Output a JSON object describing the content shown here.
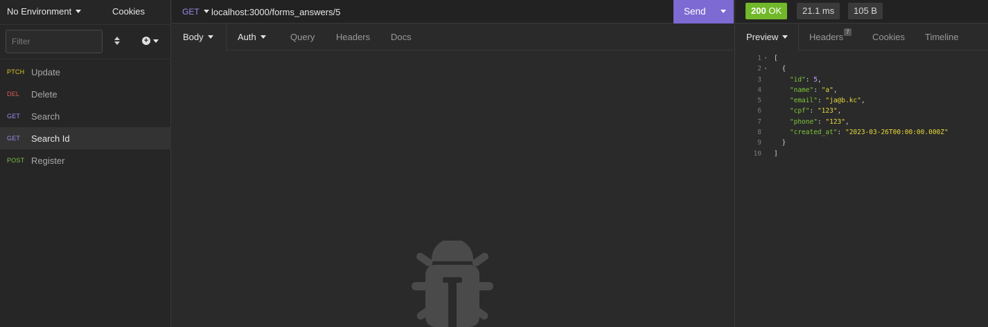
{
  "sidebar": {
    "environment": "No Environment",
    "cookies_label": "Cookies",
    "filter_placeholder": "Filter",
    "requests": [
      {
        "method": "PTCH",
        "name": "Update"
      },
      {
        "method": "DEL",
        "name": "Delete"
      },
      {
        "method": "GET",
        "name": "Search"
      },
      {
        "method": "GET",
        "name": "Search Id"
      },
      {
        "method": "POST",
        "name": "Register"
      }
    ]
  },
  "request": {
    "method": "GET",
    "url": "localhost:3000/forms_answers/5",
    "send_label": "Send",
    "tabs": {
      "body": "Body",
      "auth": "Auth",
      "query": "Query",
      "headers": "Headers",
      "docs": "Docs"
    }
  },
  "response": {
    "status": "200",
    "status_text": "OK",
    "time": "21.1 ms",
    "size": "105 B",
    "tabs": {
      "preview": "Preview",
      "headers": "Headers",
      "headers_count": "7",
      "cookies": "Cookies",
      "timeline": "Timeline"
    },
    "json_lines": [
      {
        "n": "1",
        "text": "["
      },
      {
        "n": "2",
        "text": "  {"
      },
      {
        "n": "3",
        "key": "\"id\"",
        "value": "5",
        "type": "num"
      },
      {
        "n": "4",
        "key": "\"name\"",
        "value": "\"a\"",
        "type": "str"
      },
      {
        "n": "5",
        "key": "\"email\"",
        "value": "\"ja@b.kc\"",
        "type": "str"
      },
      {
        "n": "6",
        "key": "\"cpf\"",
        "value": "\"123\"",
        "type": "str"
      },
      {
        "n": "7",
        "key": "\"phone\"",
        "value": "\"123\"",
        "type": "str"
      },
      {
        "n": "8",
        "key": "\"created_at\"",
        "value": "\"2023-03-26T00:00:00.000Z\"",
        "type": "str",
        "last": true
      },
      {
        "n": "9",
        "text": "  }"
      },
      {
        "n": "10",
        "text": "]"
      }
    ]
  },
  "colors": {
    "accent": "#7e6ad3",
    "status_ok": "#71b82a",
    "method_patch": "#d9c91c",
    "method_delete": "#e05a5a",
    "method_get": "#9c8cf0",
    "method_post": "#7cc242"
  },
  "icons": {
    "sort": "sort-updown-icon",
    "add": "plus-circle-icon",
    "empty_state": "bug-icon"
  }
}
